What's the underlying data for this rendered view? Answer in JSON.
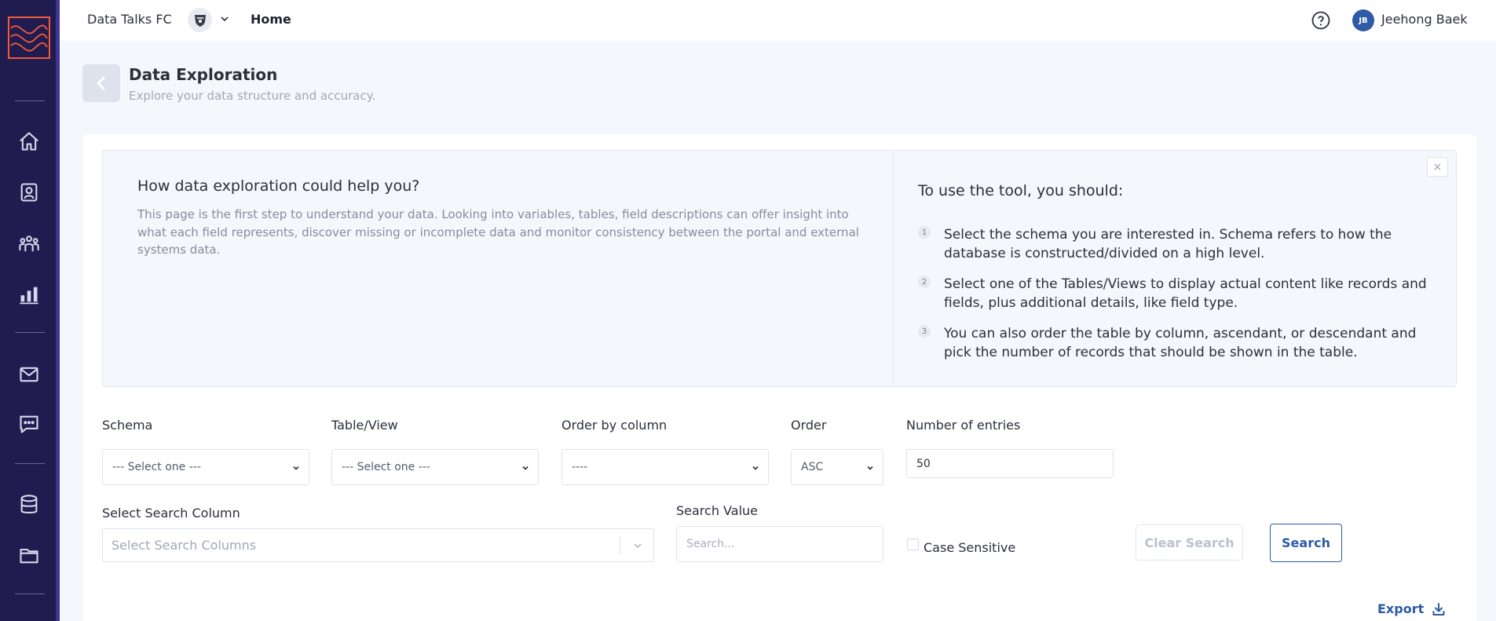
{
  "topbar": {
    "org_name": "Data Talks FC",
    "nav_home": "Home",
    "user_initials": "JB",
    "user_name": "Jeehong Baek"
  },
  "sidebar": {
    "icons": [
      "home-icon",
      "profile-icon",
      "team-icon",
      "bar-chart-icon",
      "mail-icon",
      "chat-icon",
      "database-icon",
      "folder-icon"
    ]
  },
  "header": {
    "title": "Data Exploration",
    "subtitle": "Explore your data structure and accuracy."
  },
  "info": {
    "left_title": "How data exploration could help you?",
    "left_body": "This page is the first step to understand your data. Looking into variables, tables, field descriptions can offer insight into what each field represents, discover missing or incomplete data and monitor consistency between the portal and external systems data.",
    "right_title": "To use the tool, you should:",
    "steps": [
      {
        "num": "1",
        "text": "Select the schema you are interested in. Schema refers to how the database is constructed/divided on a high level."
      },
      {
        "num": "2",
        "text": "Select one of the Tables/Views to display actual content like records and fields, plus additional details, like field type."
      },
      {
        "num": "3",
        "text": "You can also order the table by column, ascendant, or descendant and pick the number of records that should be shown in the table."
      }
    ],
    "close": "×"
  },
  "form": {
    "schema_label": "Schema",
    "schema_value": "--- Select one ---",
    "table_label": "Table/View",
    "table_value": "--- Select one ---",
    "order_col_label": "Order by column",
    "order_col_value": "----",
    "order_label": "Order",
    "order_value": "ASC",
    "entries_label": "Number of entries",
    "entries_value": "50",
    "search_col_label": "Select Search Column",
    "search_col_placeholder": "Select Search Columns",
    "search_value_label": "Search Value",
    "search_value_placeholder": "Search...",
    "case_sensitive_label": "Case Sensitive",
    "clear_label": "Clear Search",
    "search_label": "Search",
    "export_label": "Export"
  },
  "colors": {
    "sidebar_bg": "#211c4f",
    "accent": "#2e5aa8",
    "logo": "#f05a3a"
  }
}
